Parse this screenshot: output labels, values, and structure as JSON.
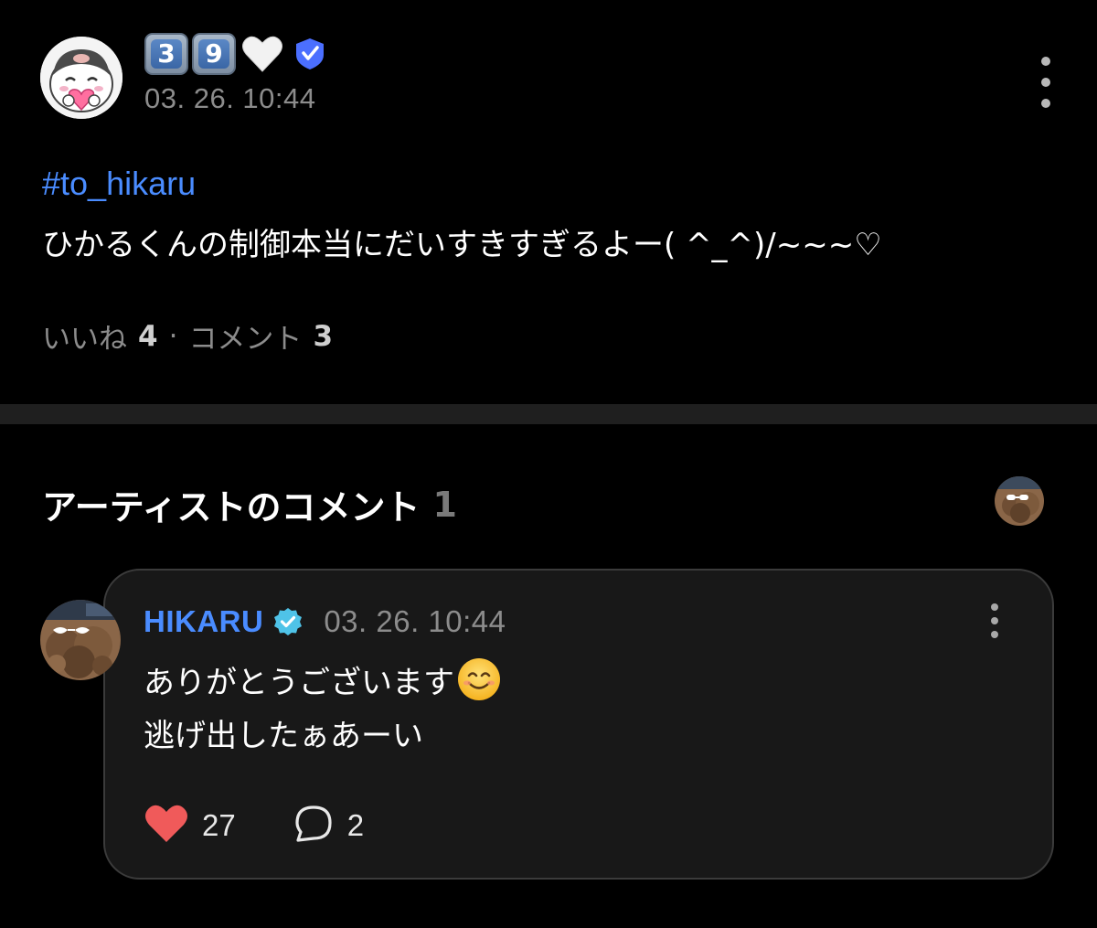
{
  "post": {
    "author_display": {
      "keycap_digits": [
        "3",
        "9"
      ],
      "heart_icon": "white-heart-icon",
      "badge_icon": "verified-shield-icon",
      "badge_color": "#4b6fff"
    },
    "timestamp": "03. 26. 10:44",
    "hashtag": "#to_hikaru",
    "body": "ひかるくんの制御本当にだいすきすぎるよー( ^_^)/~~~♡",
    "likes_label": "いいね",
    "likes_count": "4",
    "separator": "·",
    "comments_label": "コメント",
    "comments_count": "3"
  },
  "artist_section": {
    "title": "アーティストのコメント",
    "count": "1"
  },
  "comment": {
    "author": "HIKARU",
    "verified_icon": "verified-check-icon",
    "verified_color": "#4fc3e8",
    "timestamp": "03. 26. 10:44",
    "line1": "ありがとうございます",
    "line1_emoji": "smiling-face-icon",
    "line2": "逃げ出したぁあーい",
    "like_count": "27",
    "reply_count": "2"
  },
  "colors": {
    "accent_link": "#4a8cff",
    "like_heart": "#f05a5a",
    "muted_text": "#8c8c8c",
    "background": "#000000",
    "card": "#181818"
  }
}
